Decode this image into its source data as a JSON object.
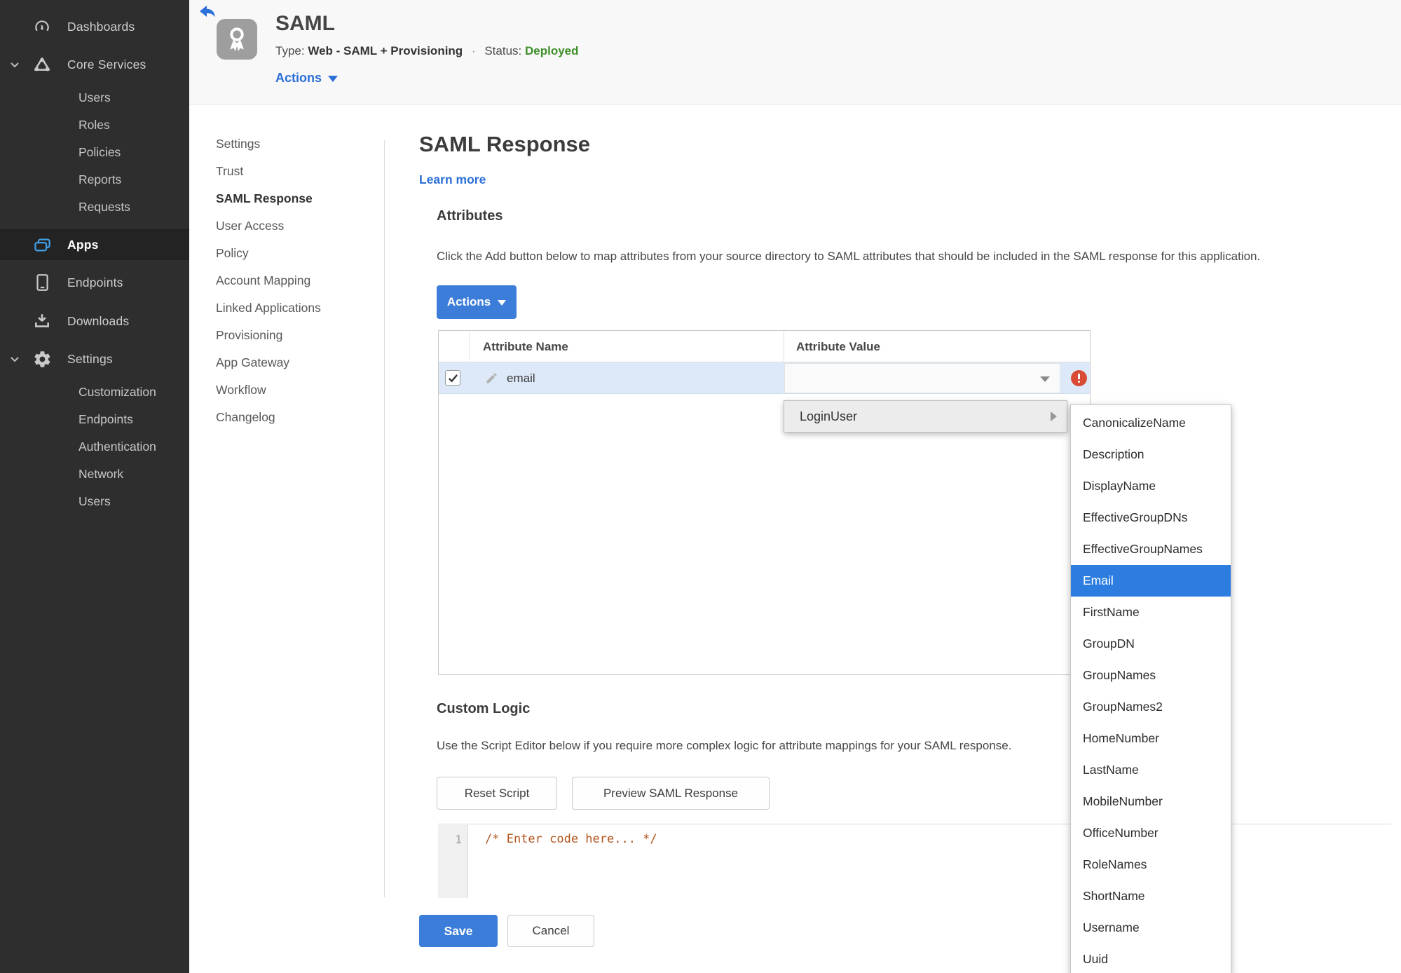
{
  "colors": {
    "accent_blue": "#3b7dd8",
    "link_blue": "#2b6fd8",
    "status_green": "#3e8f29",
    "error_red": "#d94b35",
    "selection_blue": "#2d7de1",
    "sidebar_bg": "#2e2e2e",
    "row_selected_bg": "#dde9f8"
  },
  "sidebar": {
    "items": [
      {
        "label": "Dashboards",
        "icon": "gauge-icon"
      },
      {
        "label": "Core Services",
        "icon": "core-services-icon",
        "expanded": true,
        "children": [
          "Users",
          "Roles",
          "Policies",
          "Reports",
          "Requests"
        ]
      },
      {
        "label": "Apps",
        "icon": "apps-icon",
        "active": true
      },
      {
        "label": "Endpoints",
        "icon": "tablet-icon"
      },
      {
        "label": "Downloads",
        "icon": "download-icon"
      },
      {
        "label": "Settings",
        "icon": "gear-icon",
        "expanded": true,
        "children": [
          "Customization",
          "Endpoints",
          "Authentication",
          "Network",
          "Users"
        ]
      }
    ]
  },
  "header": {
    "app_title": "SAML",
    "type_label": "Type:",
    "type_value": "Web - SAML + Provisioning",
    "separator": "·",
    "status_label": "Status:",
    "status_value": "Deployed",
    "actions_label": "Actions",
    "app_icon": "award-ribbon-icon",
    "back_icon": "back-arrow-icon"
  },
  "nav": {
    "active": "SAML Response",
    "items": [
      "Settings",
      "Trust",
      "SAML Response",
      "User Access",
      "Policy",
      "Account Mapping",
      "Linked Applications",
      "Provisioning",
      "App Gateway",
      "Workflow",
      "Changelog"
    ]
  },
  "main": {
    "title": "SAML Response",
    "learn_more": "Learn more",
    "attributes": {
      "heading": "Attributes",
      "description": "Click the Add button below to map attributes from your source directory to SAML attributes that should be included in the SAML response for this application.",
      "actions_button": "Actions",
      "table": {
        "columns": [
          "Attribute Name",
          "Attribute Value"
        ],
        "row": {
          "checked": true,
          "name": "email",
          "value": "",
          "error": true
        }
      }
    },
    "value_menu": {
      "root_item": "LoginUser",
      "selected": "Email",
      "options": [
        "CanonicalizeName",
        "Description",
        "DisplayName",
        "EffectiveGroupDNs",
        "EffectiveGroupNames",
        "Email",
        "FirstName",
        "GroupDN",
        "GroupNames",
        "GroupNames2",
        "HomeNumber",
        "LastName",
        "MobileNumber",
        "OfficeNumber",
        "RoleNames",
        "ShortName",
        "Username",
        "Uuid"
      ]
    },
    "custom_logic": {
      "heading": "Custom Logic",
      "description": "Use the Script Editor below if you require more complex logic for attribute mappings for your SAML response.",
      "reset_button": "Reset Script",
      "preview_button": "Preview SAML Response",
      "editor": {
        "line_number": "1",
        "code": "/* Enter code here... */"
      }
    },
    "save_button": "Save",
    "cancel_button": "Cancel"
  }
}
